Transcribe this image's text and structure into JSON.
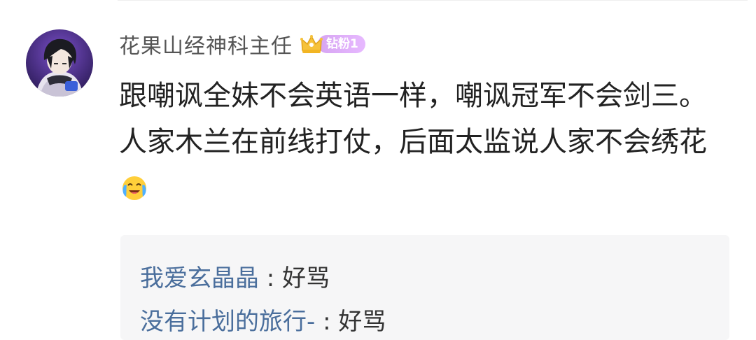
{
  "comment": {
    "username": "花果山经神科主任",
    "badge_label": "钻粉1",
    "text": "跟嘲讽全妹不会英语一样，嘲讽冠军不会剑三。人家木兰在前线打仗，后面太监说人家不会绣花",
    "emoji": "crying-laughing-face-icon"
  },
  "replies": [
    {
      "user": "我爱玄晶晶",
      "separator": " : ",
      "text": "好骂"
    },
    {
      "user": "没有计划的旅行-",
      "separator": " : ",
      "text": "好骂"
    }
  ],
  "colors": {
    "username": "#555555",
    "comment_text": "#222222",
    "reply_user": "#4a6e9c",
    "reply_bg": "#f6f6f7",
    "badge_gradient_start": "#d6a4f2",
    "badge_gradient_end": "#e7b9ff"
  }
}
